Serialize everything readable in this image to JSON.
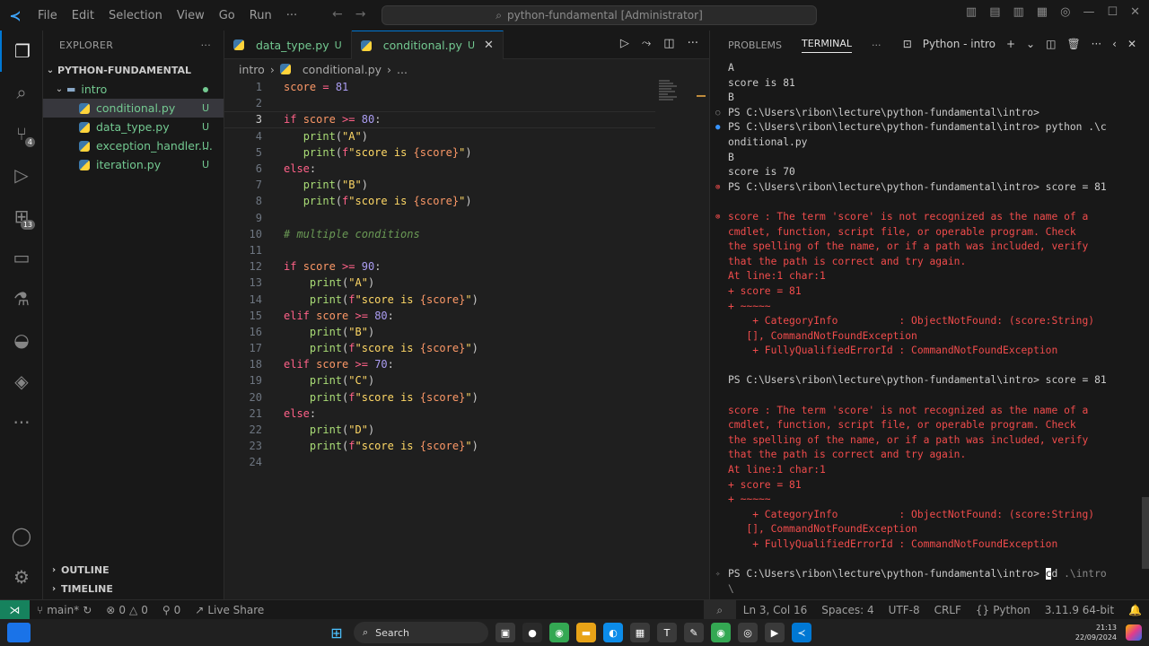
{
  "titlebar": {
    "menu": [
      "File",
      "Edit",
      "Selection",
      "View",
      "Go",
      "Run",
      "···"
    ],
    "command_center": "python-fundamental [Administrator]"
  },
  "activity": {
    "badges": {
      "scm": "4",
      "extensions": "13"
    }
  },
  "explorer": {
    "header": "EXPLORER",
    "root": "PYTHON-FUNDAMENTAL",
    "folder": "intro",
    "files": [
      {
        "name": "conditional.py",
        "status": "U"
      },
      {
        "name": "data_type.py",
        "status": "U"
      },
      {
        "name": "exception_handler....",
        "status": "U"
      },
      {
        "name": "iteration.py",
        "status": "U"
      }
    ],
    "outline": "OUTLINE",
    "timeline": "TIMELINE"
  },
  "editor": {
    "tabs": [
      {
        "name": "data_type.py",
        "status": "U"
      },
      {
        "name": "conditional.py",
        "status": "U"
      }
    ],
    "breadcrumb": [
      "intro",
      "conditional.py",
      "..."
    ],
    "current_line": 3
  },
  "panel": {
    "tabs": [
      "PROBLEMS",
      "TERMINAL"
    ],
    "active_tab": "TERMINAL",
    "terminal_name": "Python - intro"
  },
  "statusbar": {
    "branch": "main*",
    "errors": "0",
    "warnings": "0",
    "ports": "0",
    "live_share": "Live Share",
    "position": "Ln 3, Col 16",
    "spaces": "Spaces: 4",
    "encoding": "UTF-8",
    "eol": "CRLF",
    "language": "Python",
    "interpreter": "3.11.9 64-bit"
  },
  "taskbar": {
    "search": "Search",
    "time": "21:13",
    "date": "22/09/2024"
  },
  "colors": {
    "accent": "#0078d4",
    "remote": "#16825d",
    "untracked": "#73c991",
    "error": "#f14c4c"
  }
}
